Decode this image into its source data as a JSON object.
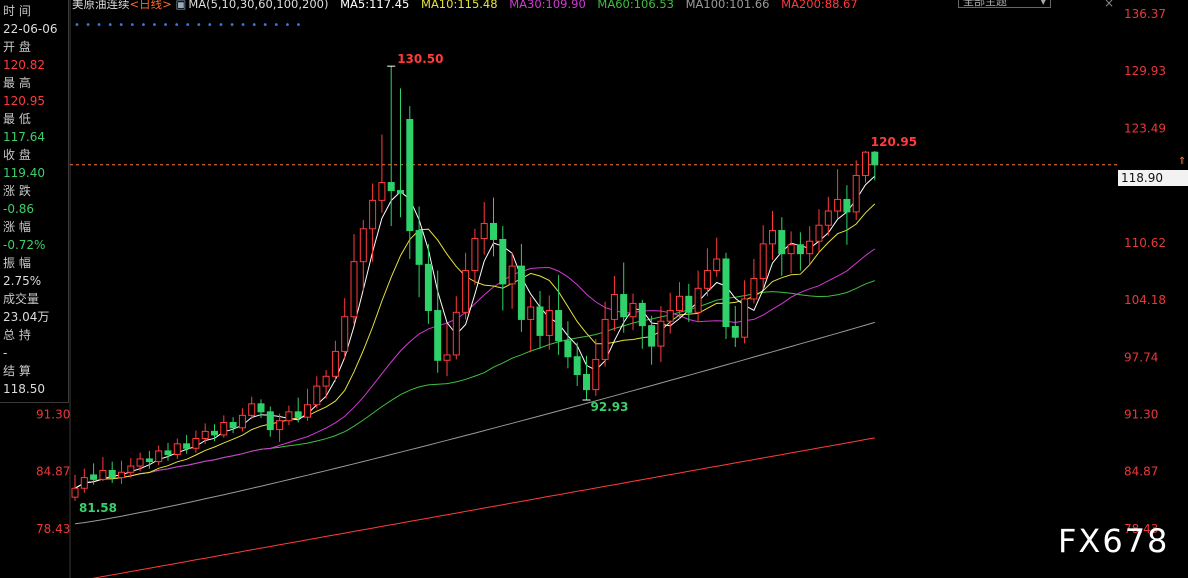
{
  "info_panel": {
    "items": [
      {
        "label": "时 间",
        "value": "22-06-06",
        "color": "white"
      },
      {
        "label": "开 盘",
        "value": "120.82",
        "color": "red"
      },
      {
        "label": "最 高",
        "value": "120.95",
        "color": "red"
      },
      {
        "label": "最 低",
        "value": "117.64",
        "color": "green"
      },
      {
        "label": "收 盘",
        "value": "119.40",
        "color": "green"
      },
      {
        "label": "涨 跌",
        "value": "-0.86",
        "color": "green"
      },
      {
        "label": "涨 幅",
        "value": "-0.72%",
        "color": "green"
      },
      {
        "label": "振 幅",
        "value": "2.75%",
        "color": "white"
      },
      {
        "label": "成交量",
        "value": "23.04万",
        "color": "white"
      },
      {
        "label": "总 持",
        "value": "-",
        "color": "white"
      },
      {
        "label": "结 算",
        "value": "118.50",
        "color": "white"
      }
    ]
  },
  "header": {
    "title": "美原油连续",
    "period": "<日线>",
    "ma_label": "MA(5,10,30,60,100,200)",
    "ma5": "MA5:117.45",
    "ma10": "MA10:115.48",
    "ma30": "MA30:109.90",
    "ma60": "MA60:106.53",
    "ma100": "MA100:101.66",
    "ma200": "MA200:88.67",
    "period_button": "全部主题",
    "close_icon": "×",
    "dots": "• • • • • • • • • • • • • • • • • • • • •"
  },
  "colors": {
    "up": "#ff3b3b",
    "down": "#2fd16a",
    "ma5": "#ffffff",
    "ma10": "#e6e03a",
    "ma30": "#d23ad2",
    "ma60": "#3fbf3f",
    "ma100": "#9a9a9a",
    "ma200": "#ff3b3b",
    "grid": "#8a1010",
    "price_line": "#ff7a3a"
  },
  "right_axis": [
    "136.37",
    "129.93",
    "123.49",
    "118.90",
    "110.62",
    "104.18",
    "97.74",
    "91.30",
    "84.87",
    "78.43"
  ],
  "left_axis": [
    "91.30",
    "84.87",
    "78.43"
  ],
  "current_price": "118.90",
  "annotations": {
    "high": "130.50",
    "recent_high": "120.95",
    "mid_low": "92.93",
    "start_low": "81.58"
  },
  "watermark": "FX678",
  "chart_data": {
    "type": "candlestick",
    "ylim": [
      76.0,
      136.37
    ],
    "candles": [
      [
        82.0,
        83.0,
        84.5,
        81.6
      ],
      [
        83.0,
        84.2,
        85.2,
        82.5
      ],
      [
        84.5,
        84.0,
        85.8,
        83.4
      ],
      [
        84.0,
        85.0,
        86.5,
        83.8
      ],
      [
        85.0,
        84.2,
        86.0,
        83.6
      ],
      [
        84.2,
        84.8,
        86.1,
        83.5
      ],
      [
        84.8,
        85.5,
        86.4,
        84.2
      ],
      [
        85.5,
        86.3,
        87.0,
        84.9
      ],
      [
        86.3,
        86.0,
        87.2,
        85.2
      ],
      [
        86.0,
        87.2,
        87.8,
        85.6
      ],
      [
        87.2,
        86.8,
        88.1,
        86.1
      ],
      [
        86.8,
        88.0,
        88.6,
        86.3
      ],
      [
        88.0,
        87.5,
        89.0,
        86.9
      ],
      [
        87.5,
        88.6,
        89.5,
        87.0
      ],
      [
        88.6,
        89.4,
        90.3,
        88.0
      ],
      [
        89.4,
        89.0,
        90.2,
        88.3
      ],
      [
        89.0,
        90.4,
        91.2,
        88.7
      ],
      [
        90.4,
        89.8,
        91.0,
        89.2
      ],
      [
        89.8,
        91.2,
        92.0,
        89.4
      ],
      [
        91.2,
        92.5,
        93.3,
        90.8
      ],
      [
        92.5,
        91.6,
        93.0,
        90.9
      ],
      [
        91.6,
        89.6,
        92.2,
        88.8
      ],
      [
        89.6,
        90.6,
        91.4,
        88.2
      ],
      [
        90.6,
        91.6,
        92.3,
        90.1
      ],
      [
        91.6,
        91.0,
        93.2,
        90.4
      ],
      [
        91.0,
        92.4,
        94.2,
        90.6
      ],
      [
        92.4,
        94.5,
        95.6,
        92.0
      ],
      [
        94.5,
        95.6,
        96.3,
        93.1
      ],
      [
        95.6,
        98.4,
        99.6,
        95.0
      ],
      [
        98.4,
        102.3,
        104.4,
        97.6
      ],
      [
        102.3,
        108.5,
        111.6,
        101.5
      ],
      [
        108.5,
        112.2,
        113.2,
        105.2
      ],
      [
        112.2,
        115.4,
        117.3,
        108.5
      ],
      [
        115.4,
        117.4,
        122.8,
        114.0
      ],
      [
        117.4,
        116.5,
        130.5,
        112.5
      ],
      [
        116.5,
        116.2,
        128.0,
        113.5
      ],
      [
        124.5,
        112.0,
        126.0,
        108.8
      ],
      [
        112.0,
        108.2,
        114.7,
        104.5
      ],
      [
        108.2,
        103.0,
        110.5,
        101.5
      ],
      [
        103.0,
        97.4,
        107.5,
        96.0
      ],
      [
        97.4,
        98.0,
        101.5,
        95.6
      ],
      [
        98.0,
        102.8,
        104.6,
        97.5
      ],
      [
        102.8,
        107.5,
        109.5,
        102.0
      ],
      [
        107.5,
        111.1,
        112.2,
        105.9
      ],
      [
        111.1,
        112.8,
        115.2,
        109.3
      ],
      [
        112.8,
        111.0,
        115.7,
        109.1
      ],
      [
        111.0,
        106.0,
        112.5,
        103.0
      ],
      [
        106.0,
        108.0,
        109.5,
        103.2
      ],
      [
        108.0,
        102.0,
        110.5,
        100.6
      ],
      [
        102.0,
        103.4,
        104.5,
        98.3
      ],
      [
        103.4,
        100.2,
        105.2,
        98.7
      ],
      [
        100.2,
        103.0,
        104.7,
        98.6
      ],
      [
        103.0,
        99.6,
        107.0,
        98.0
      ],
      [
        99.6,
        97.8,
        101.8,
        96.5
      ],
      [
        97.8,
        95.8,
        99.4,
        94.5
      ],
      [
        95.8,
        94.1,
        97.9,
        92.93
      ],
      [
        94.1,
        97.5,
        99.8,
        93.4
      ],
      [
        97.5,
        102.0,
        104.0,
        96.7
      ],
      [
        102.0,
        104.8,
        106.9,
        100.7
      ],
      [
        104.8,
        102.3,
        108.4,
        100.5
      ],
      [
        102.3,
        103.8,
        104.9,
        100.8
      ],
      [
        103.8,
        101.3,
        104.2,
        98.7
      ],
      [
        101.3,
        99.0,
        102.4,
        96.9
      ],
      [
        99.0,
        101.8,
        103.5,
        97.2
      ],
      [
        101.8,
        103.0,
        105.0,
        100.4
      ],
      [
        103.0,
        104.6,
        106.2,
        102.1
      ],
      [
        104.6,
        102.8,
        106.0,
        101.7
      ],
      [
        102.8,
        105.5,
        107.5,
        101.8
      ],
      [
        105.5,
        107.5,
        110.0,
        104.6
      ],
      [
        107.5,
        108.8,
        111.2,
        106.8
      ],
      [
        108.8,
        101.2,
        109.5,
        99.8
      ],
      [
        101.2,
        100.0,
        103.5,
        98.9
      ],
      [
        100.0,
        104.3,
        106.4,
        99.3
      ],
      [
        104.3,
        106.6,
        108.8,
        103.8
      ],
      [
        106.6,
        110.5,
        112.6,
        105.4
      ],
      [
        110.5,
        112.0,
        114.2,
        108.7
      ],
      [
        112.0,
        109.4,
        113.5,
        106.9
      ],
      [
        109.4,
        110.4,
        111.9,
        107.2
      ],
      [
        110.4,
        109.4,
        111.8,
        107.5
      ],
      [
        109.4,
        110.8,
        112.5,
        108.2
      ],
      [
        110.8,
        112.6,
        114.4,
        109.5
      ],
      [
        112.6,
        114.2,
        115.8,
        111.4
      ],
      [
        114.2,
        115.5,
        118.9,
        113.3
      ],
      [
        115.5,
        114.1,
        117.1,
        110.4
      ],
      [
        114.1,
        118.2,
        119.9,
        113.2
      ],
      [
        118.2,
        120.82,
        120.95,
        117.4
      ],
      [
        120.82,
        119.4,
        120.95,
        117.64
      ]
    ]
  }
}
